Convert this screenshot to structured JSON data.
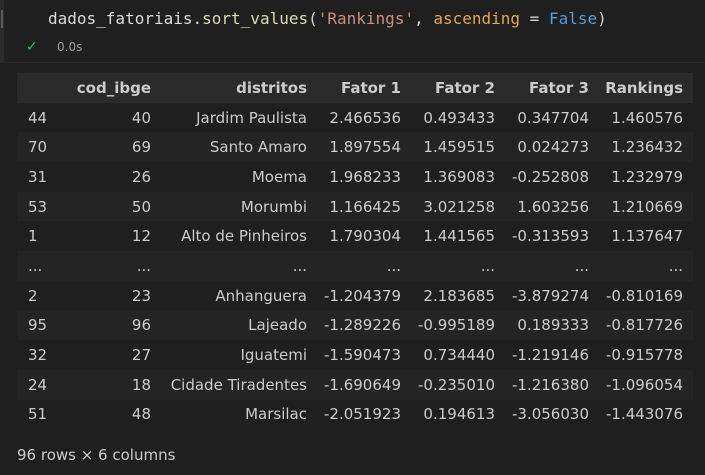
{
  "cell": {
    "code_tokens": [
      {
        "text": "dados_fatoriais",
        "cls": "tk-id"
      },
      {
        "text": ".",
        "cls": "tk-punc"
      },
      {
        "text": "sort_values",
        "cls": "tk-fn"
      },
      {
        "text": "(",
        "cls": "tk-punc"
      },
      {
        "text": "'Rankings'",
        "cls": "tk-str"
      },
      {
        "text": ", ",
        "cls": "tk-punc"
      },
      {
        "text": "ascending",
        "cls": "tk-param"
      },
      {
        "text": " = ",
        "cls": "tk-punc"
      },
      {
        "text": "False",
        "cls": "tk-bool"
      },
      {
        "text": ")",
        "cls": "tk-punc"
      }
    ],
    "status_icon": "check-icon",
    "exec_time": "0.0s"
  },
  "table": {
    "headers": [
      "",
      "cod_ibge",
      "distritos",
      "Fator 1",
      "Fator 2",
      "Fator 3",
      "Rankings"
    ],
    "rows": [
      [
        "44",
        "40",
        "Jardim Paulista",
        "2.466536",
        "0.493433",
        "0.347704",
        "1.460576"
      ],
      [
        "70",
        "69",
        "Santo Amaro",
        "1.897554",
        "1.459515",
        "0.024273",
        "1.236432"
      ],
      [
        "31",
        "26",
        "Moema",
        "1.968233",
        "1.369083",
        "-0.252808",
        "1.232979"
      ],
      [
        "53",
        "50",
        "Morumbi",
        "1.166425",
        "3.021258",
        "1.603256",
        "1.210669"
      ],
      [
        "1",
        "12",
        "Alto de Pinheiros",
        "1.790304",
        "1.441565",
        "-0.313593",
        "1.137647"
      ],
      [
        "...",
        "...",
        "...",
        "...",
        "...",
        "...",
        "..."
      ],
      [
        "2",
        "23",
        "Anhanguera",
        "-1.204379",
        "2.183685",
        "-3.879274",
        "-0.810169"
      ],
      [
        "95",
        "96",
        "Lajeado",
        "-1.289226",
        "-0.995189",
        "0.189333",
        "-0.817726"
      ],
      [
        "32",
        "27",
        "Iguatemi",
        "-1.590473",
        "0.734440",
        "-1.219146",
        "-0.915778"
      ],
      [
        "24",
        "18",
        "Cidade Tiradentes",
        "-1.690649",
        "-0.235010",
        "-1.216380",
        "-1.096054"
      ],
      [
        "51",
        "48",
        "Marsilac",
        "-2.051923",
        "0.194613",
        "-3.056030",
        "-1.443076"
      ]
    ],
    "footer": "96 rows × 6 columns"
  }
}
